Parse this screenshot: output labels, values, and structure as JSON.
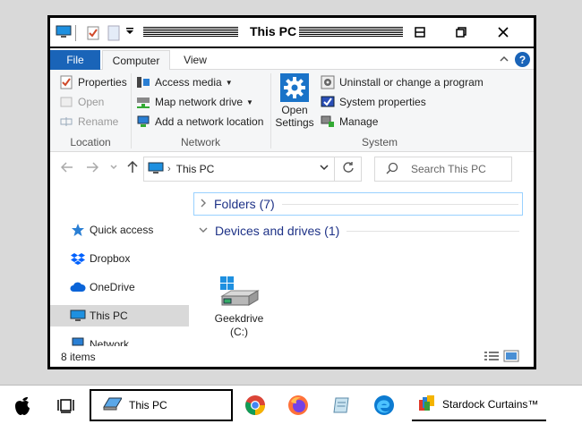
{
  "window": {
    "title": "This PC"
  },
  "ribbon_tabs": {
    "file": "File",
    "computer": "Computer",
    "view": "View",
    "help": "?"
  },
  "ribbon": {
    "location": {
      "label": "Location",
      "properties": "Properties",
      "open": "Open",
      "rename": "Rename"
    },
    "network": {
      "label": "Network",
      "access_media": "Access media",
      "map_network_drive": "Map network drive",
      "add_network_location": "Add a network location"
    },
    "system": {
      "label": "System",
      "open_settings_line1": "Open",
      "open_settings_line2": "Settings",
      "uninstall": "Uninstall or change a program",
      "system_properties": "System properties",
      "manage": "Manage"
    }
  },
  "address": {
    "path": "This PC",
    "search_placeholder": "Search This PC"
  },
  "nav_pane": {
    "items": [
      {
        "label": "Quick access",
        "icon": "star-icon"
      },
      {
        "label": "Dropbox",
        "icon": "dropbox-icon"
      },
      {
        "label": "OneDrive",
        "icon": "cloud-icon"
      },
      {
        "label": "This PC",
        "icon": "computer-icon",
        "selected": true
      },
      {
        "label": "Network",
        "icon": "network-icon"
      }
    ]
  },
  "content": {
    "folders_group": "Folders (7)",
    "devices_group": "Devices and drives (1)",
    "drive": {
      "name_line1": "Geekdrive",
      "name_line2": "(C:)"
    }
  },
  "status": {
    "items_count": "8 items"
  },
  "taskbar": {
    "active_task": "This PC",
    "curtains_app": "Stardock Curtains™"
  },
  "colors": {
    "accent": "#1a64b8",
    "header_text": "#1e3287",
    "selection": "#d9d9d9",
    "ribbon_bg": "#f5f6f7"
  }
}
